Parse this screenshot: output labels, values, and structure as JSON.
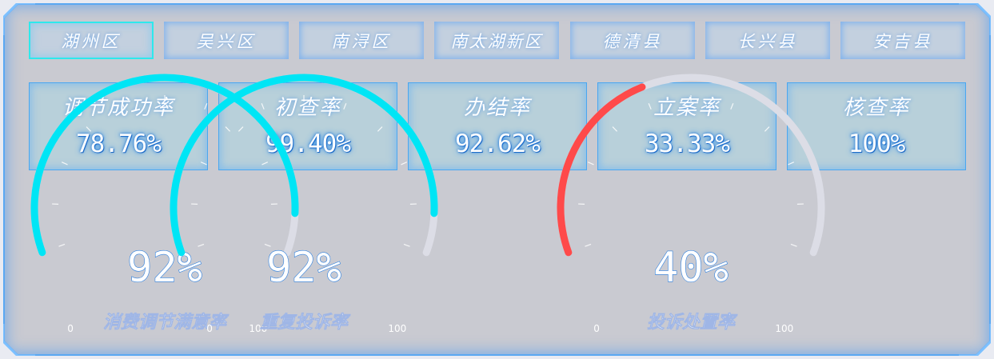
{
  "tabs": [
    {
      "label": "湖州区",
      "active": true
    },
    {
      "label": "吴兴区",
      "active": false
    },
    {
      "label": "南浔区",
      "active": false
    },
    {
      "label": "南太湖新区",
      "active": false
    },
    {
      "label": "德清县",
      "active": false
    },
    {
      "label": "长兴县",
      "active": false
    },
    {
      "label": "安吉县",
      "active": false
    }
  ],
  "kpis": [
    {
      "label": "调节成功率",
      "value": "78.76%"
    },
    {
      "label": "初查率",
      "value": "99.40%"
    },
    {
      "label": "办结率",
      "value": "92.62%"
    },
    {
      "label": "立案率",
      "value": "33.33%"
    },
    {
      "label": "核查率",
      "value": "100%"
    }
  ],
  "gauges": [
    {
      "label": "消费调节满意率",
      "value_text": "92%",
      "value": 92,
      "min_label": "0",
      "max_label": "100",
      "color": "#00e5f5",
      "track_color": "#dcdde6"
    },
    {
      "label": "重复投诉率",
      "value_text": "92%",
      "value": 92,
      "min_label": "0",
      "max_label": "100",
      "color": "#00e5f5",
      "track_color": "#dcdde6"
    },
    {
      "label": "投诉处置率",
      "value_text": "40%",
      "value": 40,
      "min_label": "0",
      "max_label": "100",
      "color": "#ff4a4a",
      "track_color": "#dcdde6"
    }
  ],
  "colors": {
    "active_tab_border": "#2ee8ec",
    "panel": "#c9cad1",
    "glow": "#4aa7f0"
  }
}
